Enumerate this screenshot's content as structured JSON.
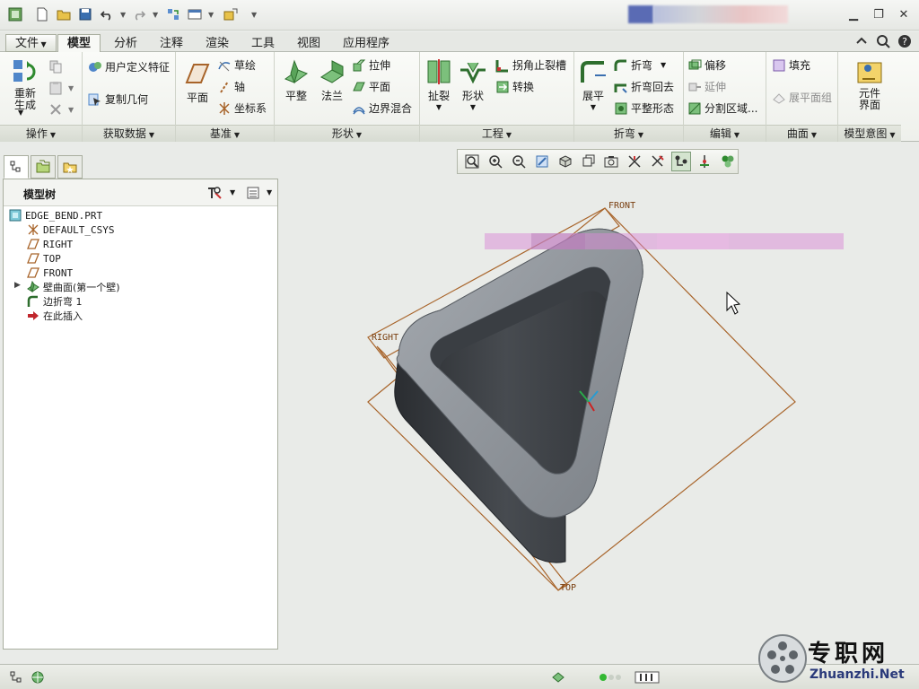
{
  "menu_tabs": [
    "文件",
    "模型",
    "分析",
    "注释",
    "渲染",
    "工具",
    "视图",
    "应用程序"
  ],
  "active_tab": "模型",
  "ribbon": {
    "operations": {
      "label": "操作",
      "regenerate": "重新生成"
    },
    "get_data": {
      "label": "获取数据",
      "udf": "用户定义特征",
      "copy_geom": "复制几何"
    },
    "datum": {
      "label": "基准",
      "plane": "平面",
      "sketch": "草绘",
      "axis": "轴",
      "csys": "坐标系"
    },
    "shapes": {
      "label": "形状",
      "flat": "平整",
      "flange": "法兰",
      "extrude": "拉伸",
      "planar": "平面",
      "boundary_blend": "边界混合"
    },
    "engineering": {
      "label": "工程",
      "rip": "扯裂",
      "form": "形状",
      "corner_relief": "拐角止裂槽",
      "convert": "转换"
    },
    "bends": {
      "label": "折弯",
      "unbend": "展平",
      "bend": "折弯",
      "bend_back": "折弯回去",
      "flatten_form": "平整形态"
    },
    "editing": {
      "label": "编辑",
      "offset": "偏移",
      "extend": "延伸",
      "split_area": "分割区域..."
    },
    "surfaces": {
      "label": "曲面",
      "fill": "填充",
      "flat_pattern": "展平面组"
    },
    "model_intent": {
      "label": "模型意图",
      "component_interface": "元件界面"
    }
  },
  "model_tree": {
    "title": "模型树",
    "items": [
      {
        "label": "EDGE_BEND.PRT",
        "icon": "part-icon"
      },
      {
        "label": "DEFAULT_CSYS",
        "icon": "csys-icon"
      },
      {
        "label": "RIGHT",
        "icon": "datum-plane-icon"
      },
      {
        "label": "TOP",
        "icon": "datum-plane-icon"
      },
      {
        "label": "FRONT",
        "icon": "datum-plane-icon"
      },
      {
        "label": "壁曲面(第一个壁)",
        "icon": "wall-icon"
      },
      {
        "label": "边折弯 1",
        "icon": "edge-bend-icon"
      },
      {
        "label": "在此插入",
        "icon": "insert-here-icon"
      }
    ]
  },
  "canvas": {
    "plane_labels": {
      "front": "FRONT",
      "right": "RIGHT",
      "top": "TOP"
    },
    "colors": {
      "background": "#e9ebe8",
      "datum": "#a8642a",
      "part_dark": "#3b3f44",
      "part_light": "#8b9096",
      "blur": "#d98ad6"
    }
  },
  "watermark": {
    "cn": "专职网",
    "en": "Zhuanzhi.Net"
  }
}
